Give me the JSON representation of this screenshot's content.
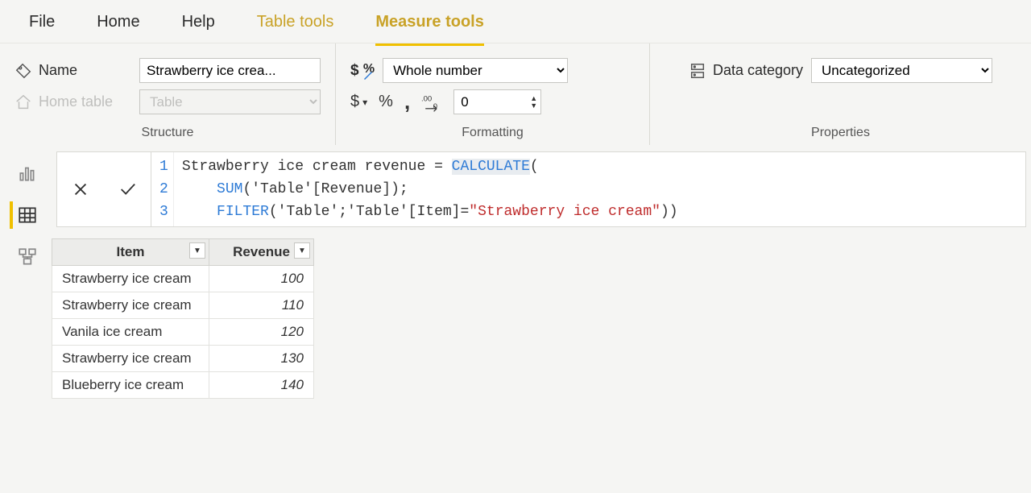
{
  "menu": {
    "file": "File",
    "home": "Home",
    "help": "Help",
    "table_tools": "Table tools",
    "measure_tools": "Measure tools"
  },
  "structure": {
    "section_title": "Structure",
    "name_label": "Name",
    "name_value": "Strawberry ice crea...",
    "home_table_label": "Home table",
    "home_table_value": "Table"
  },
  "formatting": {
    "section_title": "Formatting",
    "format_value": "Whole number",
    "decimals_value": "0"
  },
  "properties": {
    "section_title": "Properties",
    "category_label": "Data category",
    "category_value": "Uncategorized"
  },
  "formula": {
    "line1_a": "Strawberry ice cream revenue = ",
    "line1_b": "CALCULATE",
    "line1_c": "(",
    "line2_a": "SUM",
    "line2_b": "('Table'[Revenue]);",
    "line3_a": "FILTER",
    "line3_b": "('Table';'Table'[Item]=",
    "line3_c": "\"Strawberry ice cream\"",
    "line3_d": "))",
    "ln1": "1",
    "ln2": "2",
    "ln3": "3"
  },
  "table": {
    "headers": {
      "item": "Item",
      "revenue": "Revenue"
    },
    "rows": [
      {
        "item": "Strawberry ice cream",
        "rev": "100"
      },
      {
        "item": "Strawberry ice cream",
        "rev": "110"
      },
      {
        "item": "Vanila ice cream",
        "rev": "120"
      },
      {
        "item": "Strawberry ice cream",
        "rev": "130"
      },
      {
        "item": "Blueberry ice cream",
        "rev": "140"
      }
    ]
  }
}
